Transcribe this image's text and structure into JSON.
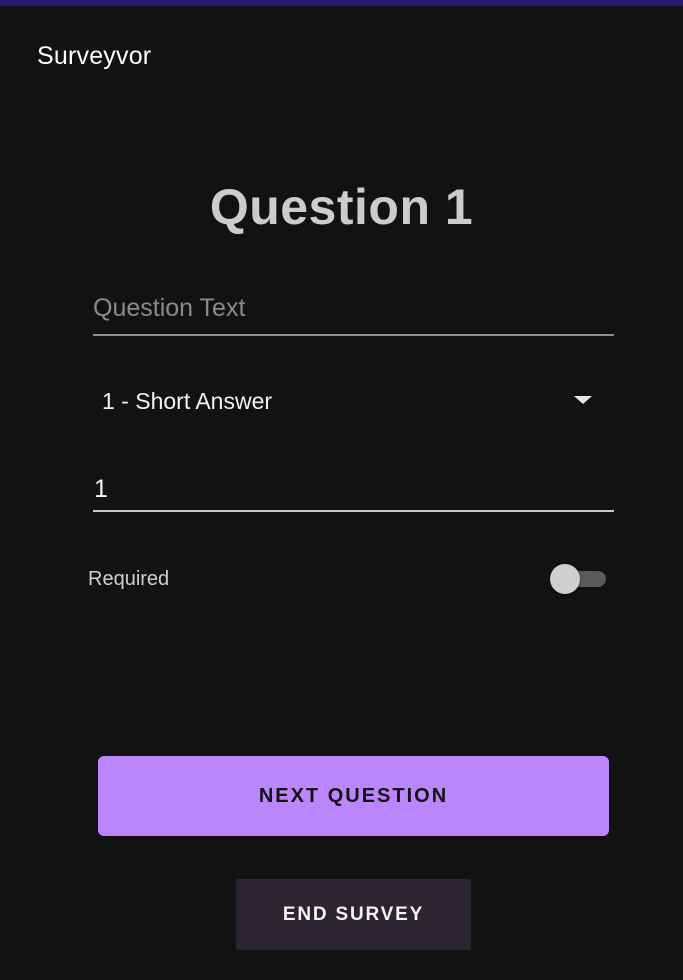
{
  "app": {
    "title": "Surveyvor"
  },
  "question": {
    "title": "Question 1",
    "text_placeholder": "Question Text",
    "type_selected": "1 - Short Answer",
    "number_value": "1",
    "required_label": "Required",
    "required_on": false
  },
  "actions": {
    "next_label": "NEXT QUESTION",
    "end_label": "END SURVEY"
  },
  "colors": {
    "accent": "#bb86fc",
    "background": "#121212",
    "secondary_button": "#2a2433"
  },
  "icons": {
    "dropdown": "chevron-down-icon"
  }
}
